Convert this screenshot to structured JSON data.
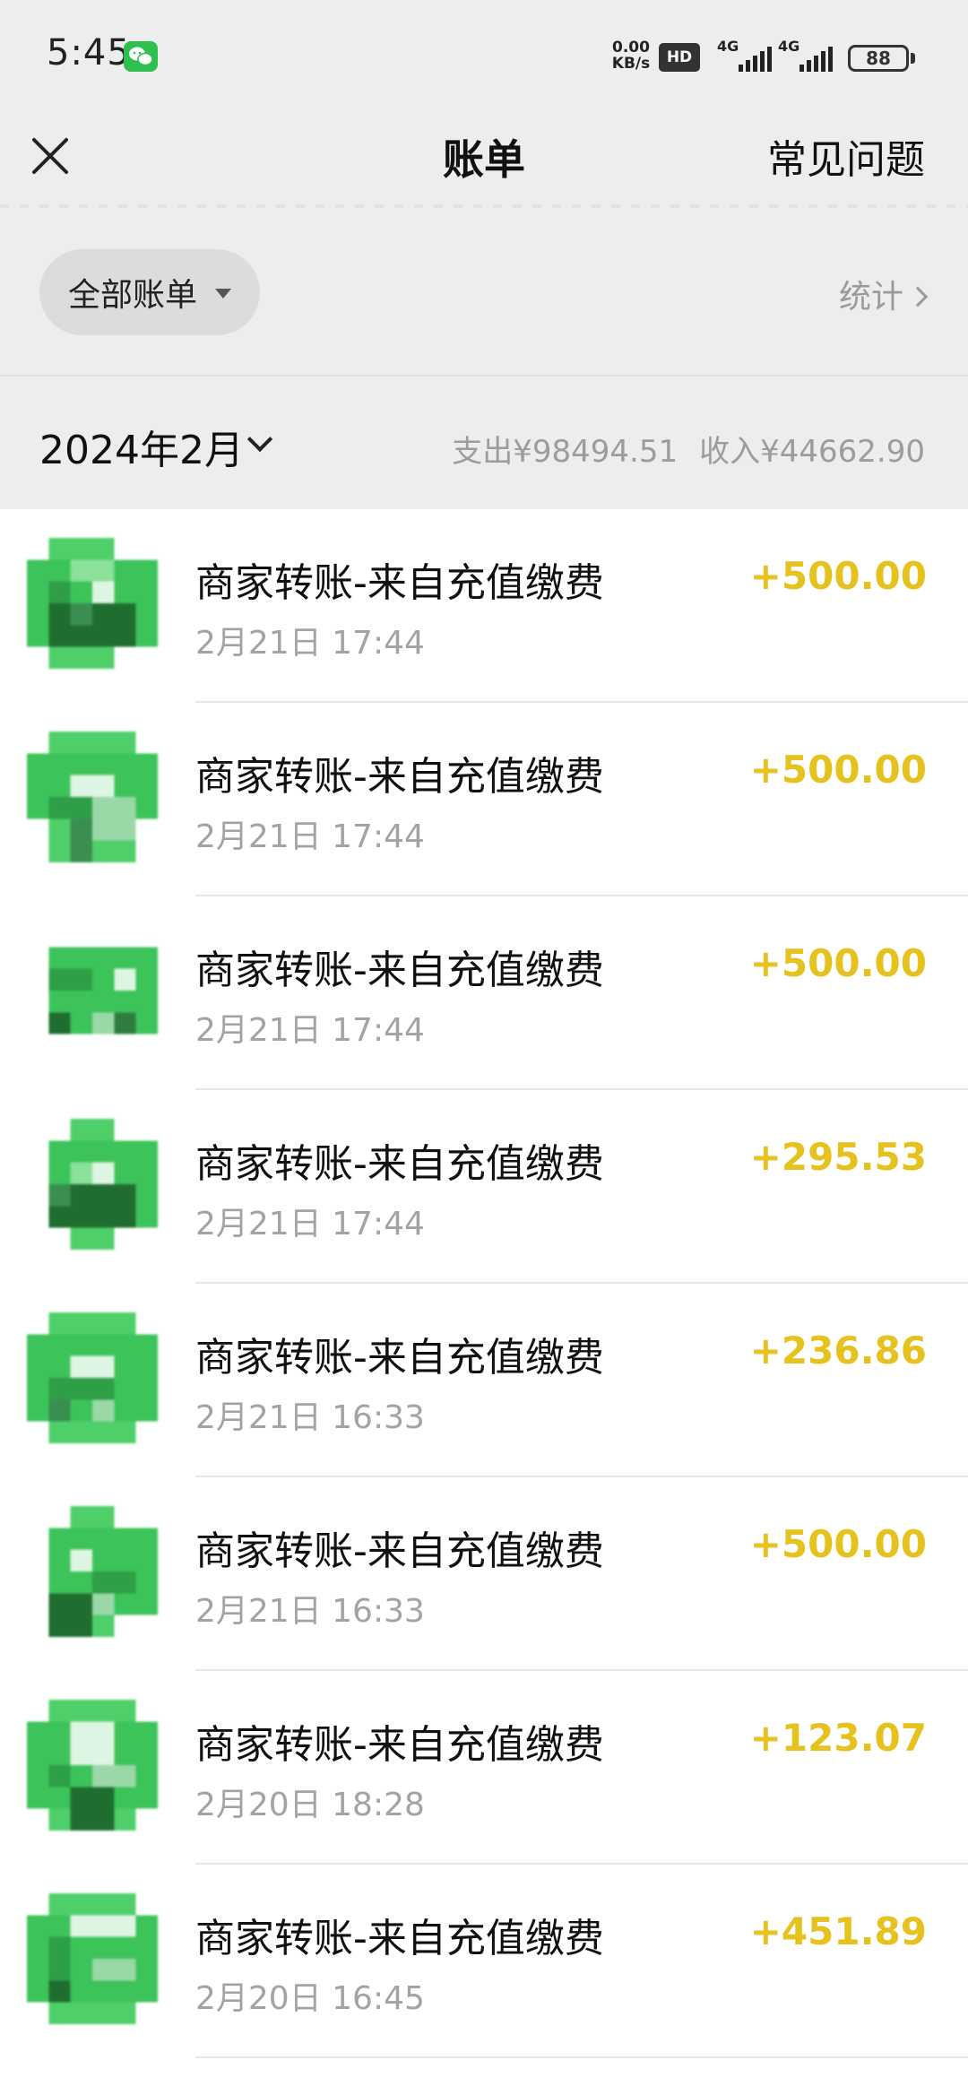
{
  "status_bar": {
    "time": "5:45",
    "net_speed_value": "0.00",
    "net_speed_unit": "KB/s",
    "hd_label": "HD",
    "signal1_tag": "4G",
    "signal2_tag": "4G",
    "battery": "88"
  },
  "nav": {
    "close_icon": "close-icon",
    "title": "账单",
    "faq_label": "常见问题"
  },
  "filter": {
    "pill_label": "全部账单",
    "stats_label": "统计"
  },
  "month": {
    "label": "2024年2月",
    "expense_label": "支出¥98494.51",
    "income_label": "收入¥44662.90"
  },
  "colors": {
    "amount": "#e6c21f",
    "avatar_green": "#3cc35a",
    "background": "#ededed"
  },
  "bills": [
    {
      "title": "商家转账-来自充值缴费",
      "time": "2月21日 17:44",
      "amount": "+500.00"
    },
    {
      "title": "商家转账-来自充值缴费",
      "time": "2月21日 17:44",
      "amount": "+500.00"
    },
    {
      "title": "商家转账-来自充值缴费",
      "time": "2月21日 17:44",
      "amount": "+500.00"
    },
    {
      "title": "商家转账-来自充值缴费",
      "time": "2月21日 17:44",
      "amount": "+295.53"
    },
    {
      "title": "商家转账-来自充值缴费",
      "time": "2月21日 16:33",
      "amount": "+236.86"
    },
    {
      "title": "商家转账-来自充值缴费",
      "time": "2月21日 16:33",
      "amount": "+500.00"
    },
    {
      "title": "商家转账-来自充值缴费",
      "time": "2月20日 18:28",
      "amount": "+123.07"
    },
    {
      "title": "商家转账-来自充值缴费",
      "time": "2月20日 16:45",
      "amount": "+451.89"
    }
  ]
}
